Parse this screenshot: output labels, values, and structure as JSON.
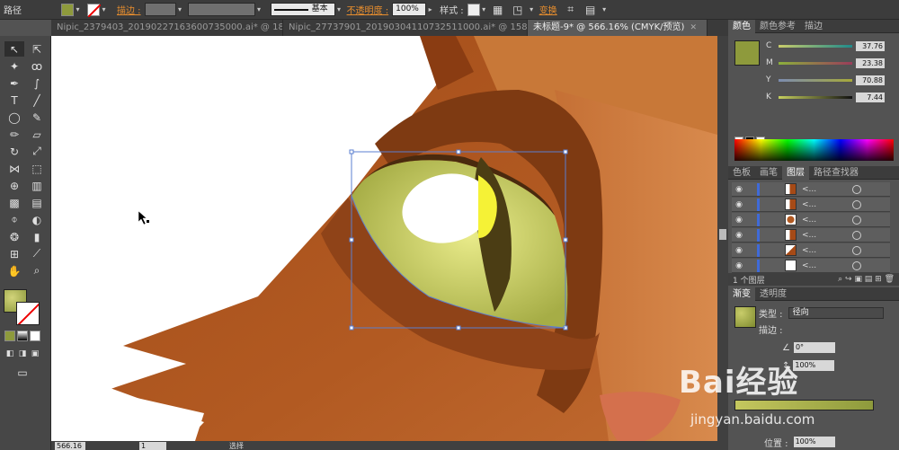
{
  "toolbar": {
    "mode_label": "路径",
    "fill_color": "#8e9a3c",
    "stroke_label": "描边 :",
    "brush_label": "基本",
    "opacity_label": "不透明度 :",
    "opacity_value": "100%",
    "style_label": "样式 :",
    "transform_label": "变换"
  },
  "tabs": [
    {
      "label": "Nipic_2379403_20190227163600735000.ai* @ 180...",
      "active": false
    },
    {
      "label": "Nipic_27737901_20190304110732511000.ai* @ 158...",
      "active": false
    },
    {
      "label": "未标题-9* @ 566.16% (CMYK/预览)",
      "active": true
    }
  ],
  "color_panel": {
    "tabs": [
      "颜色",
      "颜色参考",
      "描边"
    ],
    "swatch": "#8e9a3c",
    "c": {
      "label": "C",
      "value": "37.76"
    },
    "m": {
      "label": "M",
      "value": "23.38"
    },
    "y": {
      "label": "Y",
      "value": "70.88"
    },
    "k": {
      "label": "K",
      "value": "7.44"
    }
  },
  "layers_panel": {
    "tabs": [
      "色板",
      "画笔",
      "图层",
      "路径查找器"
    ],
    "rows": [
      "<...",
      "<...",
      "<...",
      "<...",
      "<...",
      "<..."
    ],
    "footer": "1 个图层"
  },
  "gradient_panel": {
    "tabs": [
      "渐变",
      "透明度"
    ],
    "type_label": "类型 :",
    "type_value": "径向",
    "stroke_label": "描边 :",
    "angle_value": "0°",
    "ratio_value": "100%",
    "position_label": "位置 :",
    "position_value": "100%"
  },
  "status": {
    "zoom": "566.16",
    "page": "1",
    "tool": "选择"
  },
  "watermark": {
    "main": "Bai经验",
    "sub": "jingyan.baidu.com"
  }
}
